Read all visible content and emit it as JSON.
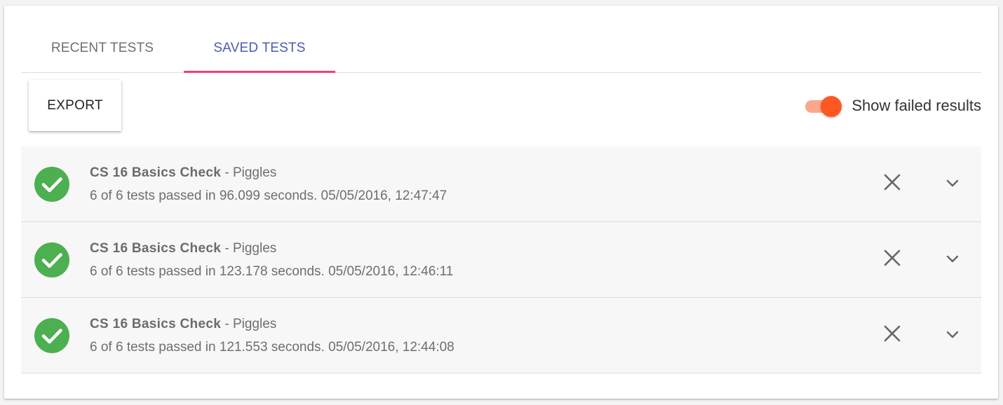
{
  "tabs": [
    {
      "label": "RECENT TESTS",
      "active": false
    },
    {
      "label": "SAVED TESTS",
      "active": true
    }
  ],
  "toolbar": {
    "export_label": "EXPORT",
    "toggle_label": "Show failed results",
    "toggle_on": true
  },
  "colors": {
    "active_tab_text": "#4a5bb5",
    "active_tab_indicator": "#ec407a",
    "toggle_thumb": "#ff5722",
    "toggle_track": "#f9a98a",
    "success": "#4caf50"
  },
  "results": [
    {
      "name": "CS 16 Basics Check",
      "separator": " - ",
      "author": "Piggles",
      "summary": "6 of 6 tests passed in 96.099 seconds. 05/05/2016, 12:47:47",
      "status_icon": "check-circle-icon",
      "status": "passed"
    },
    {
      "name": "CS 16 Basics Check",
      "separator": " - ",
      "author": "Piggles",
      "summary": "6 of 6 tests passed in 123.178 seconds. 05/05/2016, 12:46:11",
      "status_icon": "check-circle-icon",
      "status": "passed"
    },
    {
      "name": "CS 16 Basics Check",
      "separator": " - ",
      "author": "Piggles",
      "summary": "6 of 6 tests passed in 121.553 seconds. 05/05/2016, 12:44:08",
      "status_icon": "check-circle-icon",
      "status": "passed"
    }
  ],
  "row_actions": {
    "remove_icon": "close-icon",
    "expand_icon": "chevron-down-icon"
  }
}
